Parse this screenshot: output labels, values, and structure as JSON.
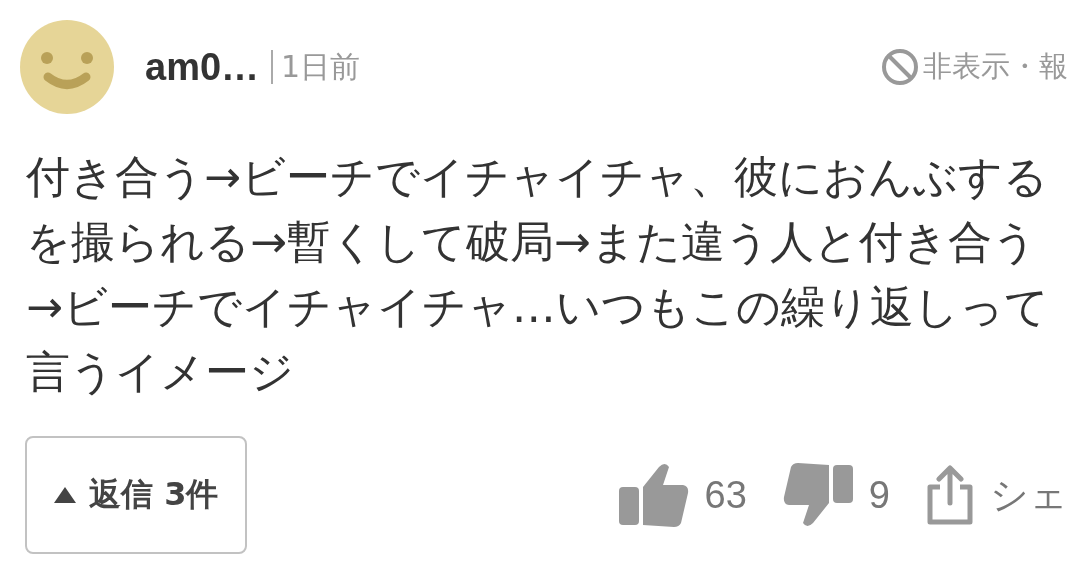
{
  "comment": {
    "author": "am0…",
    "time": "1日前",
    "hide_report": "非表示・報",
    "body_lines": [
      "付き合う→ビーチでイチャイチャ、彼におんぶする",
      "を撮られる→暫くして破局→また違う人と付き合う",
      "→ビーチでイチャイチャ…いつもこの繰り返しって",
      "言うイメージ"
    ],
    "replies": {
      "label": "返信 3件",
      "expanded": true
    },
    "likes": "63",
    "dislikes": "9",
    "share": "シェ"
  }
}
